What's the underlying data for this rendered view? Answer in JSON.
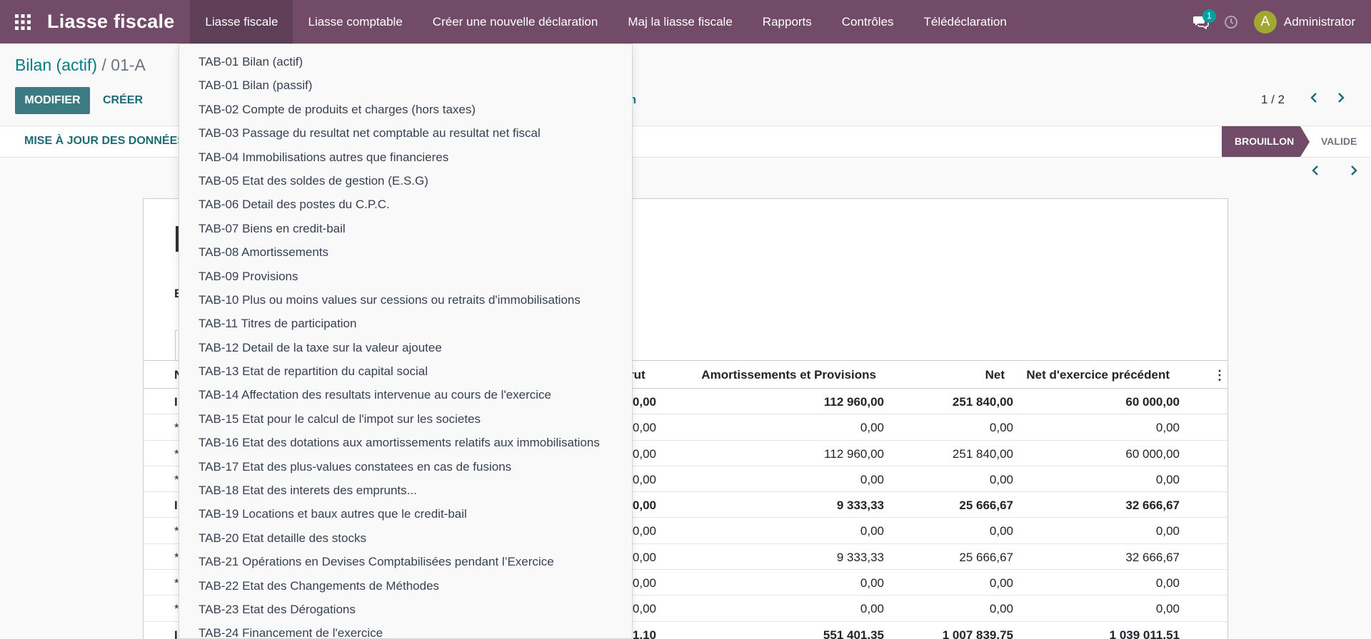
{
  "navbar": {
    "app_title": "Liasse fiscale",
    "menu": [
      "Liasse fiscale",
      "Liasse comptable",
      "Créer une nouvelle déclaration",
      "Maj la liasse fiscale",
      "Rapports",
      "Contrôles",
      "Télédéclaration"
    ],
    "chat_count": "1",
    "user_initial": "A",
    "user_name": "Administrator",
    "bg_color": "#714b67"
  },
  "breadcrumb": {
    "parent": "Bilan (actif)",
    "separator": "/",
    "current": "01-A"
  },
  "toolbar": {
    "edit_label": "MODIFIER",
    "create_label": "CRÉER",
    "partial_action": "tion"
  },
  "pager": {
    "text": "1 / 2"
  },
  "statusbar": {
    "update_label": "MISE À JOUR DES DONNÉES",
    "stages": [
      {
        "label": "BROUILLON",
        "active": true
      },
      {
        "label": "VALIDE",
        "active": false
      }
    ]
  },
  "sheet": {
    "label_fragment": "B",
    "columns": [
      "N",
      "rut",
      "Amortissements et Provisions",
      "Net",
      "Net d'exercice précédent"
    ],
    "rows": [
      {
        "first": "I",
        "brut": "0,00",
        "amort": "112 960,00",
        "net": "251 840,00",
        "prev": "60 000,00",
        "bold": true
      },
      {
        "first": "*",
        "brut": "0,00",
        "amort": "0,00",
        "net": "0,00",
        "prev": "0,00",
        "bold": false
      },
      {
        "first": "*",
        "brut": "0,00",
        "amort": "112 960,00",
        "net": "251 840,00",
        "prev": "60 000,00",
        "bold": false
      },
      {
        "first": "*",
        "brut": "0,00",
        "amort": "0,00",
        "net": "0,00",
        "prev": "0,00",
        "bold": false
      },
      {
        "first": "I",
        "brut": "0,00",
        "amort": "9 333,33",
        "net": "25 666,67",
        "prev": "32 666,67",
        "bold": true
      },
      {
        "first": "*",
        "brut": "0,00",
        "amort": "0,00",
        "net": "0,00",
        "prev": "0,00",
        "bold": false
      },
      {
        "first": "*",
        "brut": "0,00",
        "amort": "9 333,33",
        "net": "25 666,67",
        "prev": "32 666,67",
        "bold": false
      },
      {
        "first": "*",
        "brut": "0,00",
        "amort": "0,00",
        "net": "0,00",
        "prev": "0,00",
        "bold": false
      },
      {
        "first": "*",
        "brut": "0,00",
        "amort": "0,00",
        "net": "0,00",
        "prev": "0,00",
        "bold": false
      },
      {
        "first": "I",
        "brut": "1,10",
        "amort": "551 401,35",
        "net": "1 007 839,75",
        "prev": "1 039 011,51",
        "bold": true
      }
    ]
  },
  "dropdown": {
    "items": [
      "TAB-01 Bilan (actif)",
      "TAB-01 Bilan (passif)",
      "TAB-02 Compte de produits et charges (hors taxes)",
      "TAB-03 Passage du resultat net comptable au resultat net fiscal",
      "TAB-04 Immobilisations autres que financieres",
      "TAB-05 Etat des soldes de gestion (E.S.G)",
      "TAB-06 Detail des postes du C.P.C.",
      "TAB-07 Biens en credit-bail",
      "TAB-08 Amortissements",
      "TAB-09 Provisions",
      "TAB-10 Plus ou moins values sur cessions ou retraits d'immobilisations",
      "TAB-11 Titres de participation",
      "TAB-12 Detail de la taxe sur la valeur ajoutee",
      "TAB-13 Etat de repartition du capital social",
      "TAB-14 Affectation des resultats intervenue au cours de l'exercice",
      "TAB-15 Etat pour le calcul de l'impot sur les societes",
      "TAB-16 Etat des dotations aux amortissements relatifs aux immobilisations",
      "TAB-17 Etat des plus-values constatees en cas de fusions",
      "TAB-18 Etat des interets des emprunts...",
      "TAB-19 Locations et baux autres que le credit-bail",
      "TAB-20 Etat detaille des stocks",
      "TAB-21 Opérations en Devises Comptabilisées pendant l’Exercice",
      "TAB-22 Etat des Changements de Méthodes",
      "TAB-23 Etat des Dérogations",
      "TAB-24 Financement de l'exercice"
    ]
  }
}
